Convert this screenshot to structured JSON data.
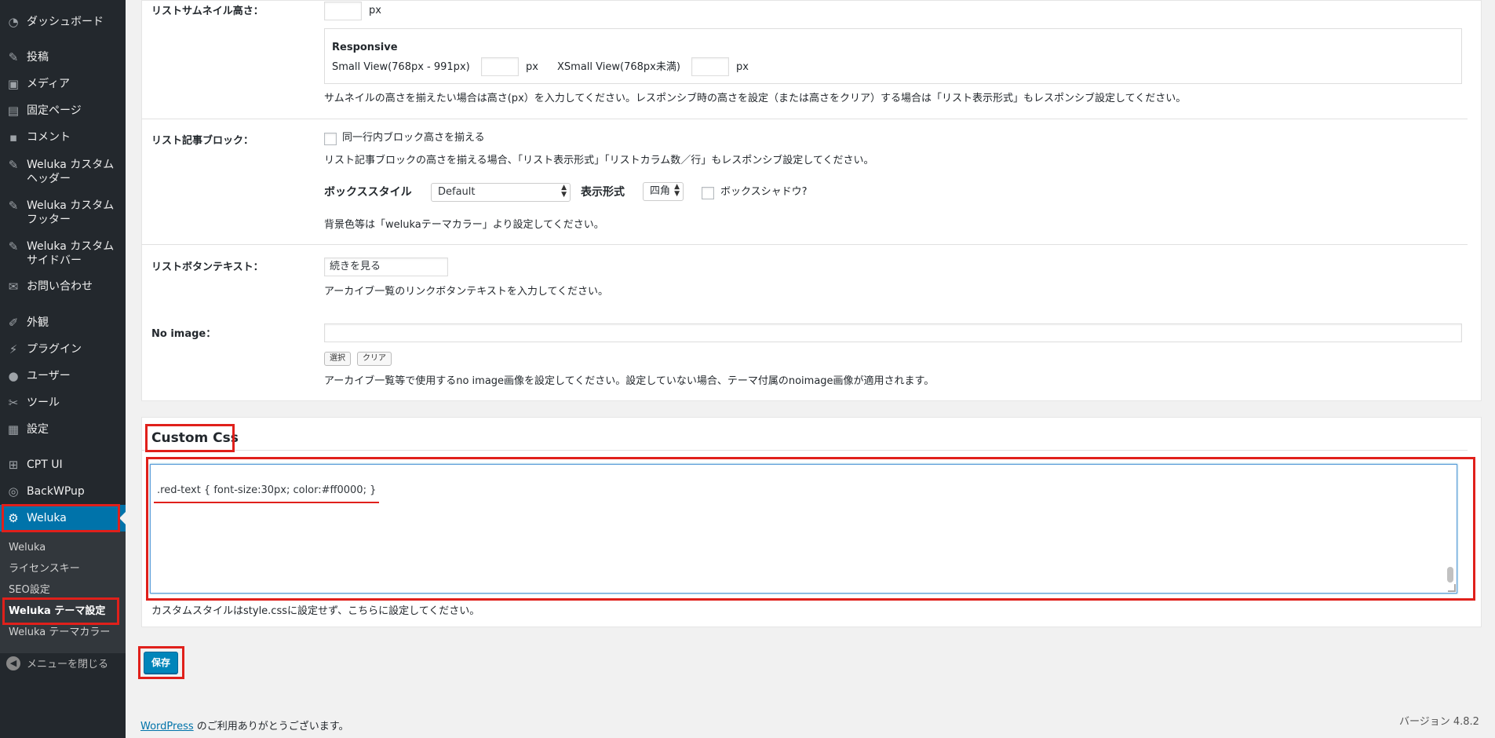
{
  "sidebar": {
    "items": [
      {
        "label": "ダッシュボード",
        "icon": "dashboard-icon"
      },
      {
        "label": "投稿",
        "icon": "pin-icon"
      },
      {
        "label": "メディア",
        "icon": "media-icon"
      },
      {
        "label": "固定ページ",
        "icon": "page-icon"
      },
      {
        "label": "コメント",
        "icon": "comment-icon"
      },
      {
        "label": "Weluka カスタムヘッダー",
        "icon": "pin-icon"
      },
      {
        "label": "Weluka カスタムフッター",
        "icon": "pin-icon"
      },
      {
        "label": "Weluka カスタムサイドバー",
        "icon": "pin-icon"
      },
      {
        "label": "お問い合わせ",
        "icon": "mail-icon"
      },
      {
        "label": "外観",
        "icon": "brush-icon"
      },
      {
        "label": "プラグイン",
        "icon": "plugin-icon"
      },
      {
        "label": "ユーザー",
        "icon": "user-icon"
      },
      {
        "label": "ツール",
        "icon": "wrench-icon"
      },
      {
        "label": "設定",
        "icon": "settings-icon"
      },
      {
        "label": "CPT UI",
        "icon": "grid-icon"
      },
      {
        "label": "BackWPup",
        "icon": "backwpup-icon"
      },
      {
        "label": "Weluka",
        "icon": "gear-icon"
      }
    ],
    "submenu": [
      "Weluka",
      "ライセンスキー",
      "SEO設定",
      "Weluka テーマ設定",
      "Weluka テーマカラー"
    ],
    "collapse_label": "メニューを閉じる"
  },
  "thumbnail": {
    "label": "リストサムネイル高さ：",
    "unit": "px",
    "responsive_title": "Responsive",
    "small_view_label": "Small View(768px - 991px)",
    "xsmall_view_label": "XSmall View(768px未満)",
    "small_unit": "px",
    "xsmall_unit": "px",
    "help": "サムネイルの高さを揃えたい場合は高さ(px）を入力してください。レスポンシブ時の高さを設定（または高さをクリア）する場合は「リスト表示形式」もレスポンシブ設定してください。"
  },
  "block": {
    "label": "リスト記事ブロック：",
    "checkbox_label": "同一行内ブロック高さを揃える",
    "help": "リスト記事ブロックの高さを揃える場合、「リスト表示形式」「リストカラム数／行」もレスポンシブ設定してください。",
    "box_style_label": "ボックススタイル",
    "box_style_value": "Default",
    "display_label": "表示形式",
    "display_value": "四角",
    "shadow_label": "ボックスシャドウ?",
    "bg_help": "背景色等は「welukaテーマカラー」より設定してください。"
  },
  "button_text": {
    "label": "リストボタンテキスト：",
    "value": "続きを見る",
    "help": "アーカイブ一覧のリンクボタンテキストを入力してください。"
  },
  "no_image": {
    "label": "No image：",
    "select_btn": "選択",
    "clear_btn": "クリア",
    "help": "アーカイブ一覧等で使用するno image画像を設定してください。設定していない場合、テーマ付属のnoimage画像が適用されます。"
  },
  "custom_css": {
    "title": "Custom Css",
    "code": ".red-text { font-size:30px; color:#ff0000; }",
    "help": "カスタムスタイルはstyle.cssに設定せず、こちらに設定してください。"
  },
  "save_label": "保存",
  "footer": {
    "link": "WordPress",
    "thanks": " のご利用ありがとうございます。",
    "version": "バージョン 4.8.2"
  },
  "colors": {
    "sidebar_bg": "#23282d",
    "active_bg": "#0073aa",
    "highlight": "#e0201b",
    "primary_button": "#0085ba"
  }
}
